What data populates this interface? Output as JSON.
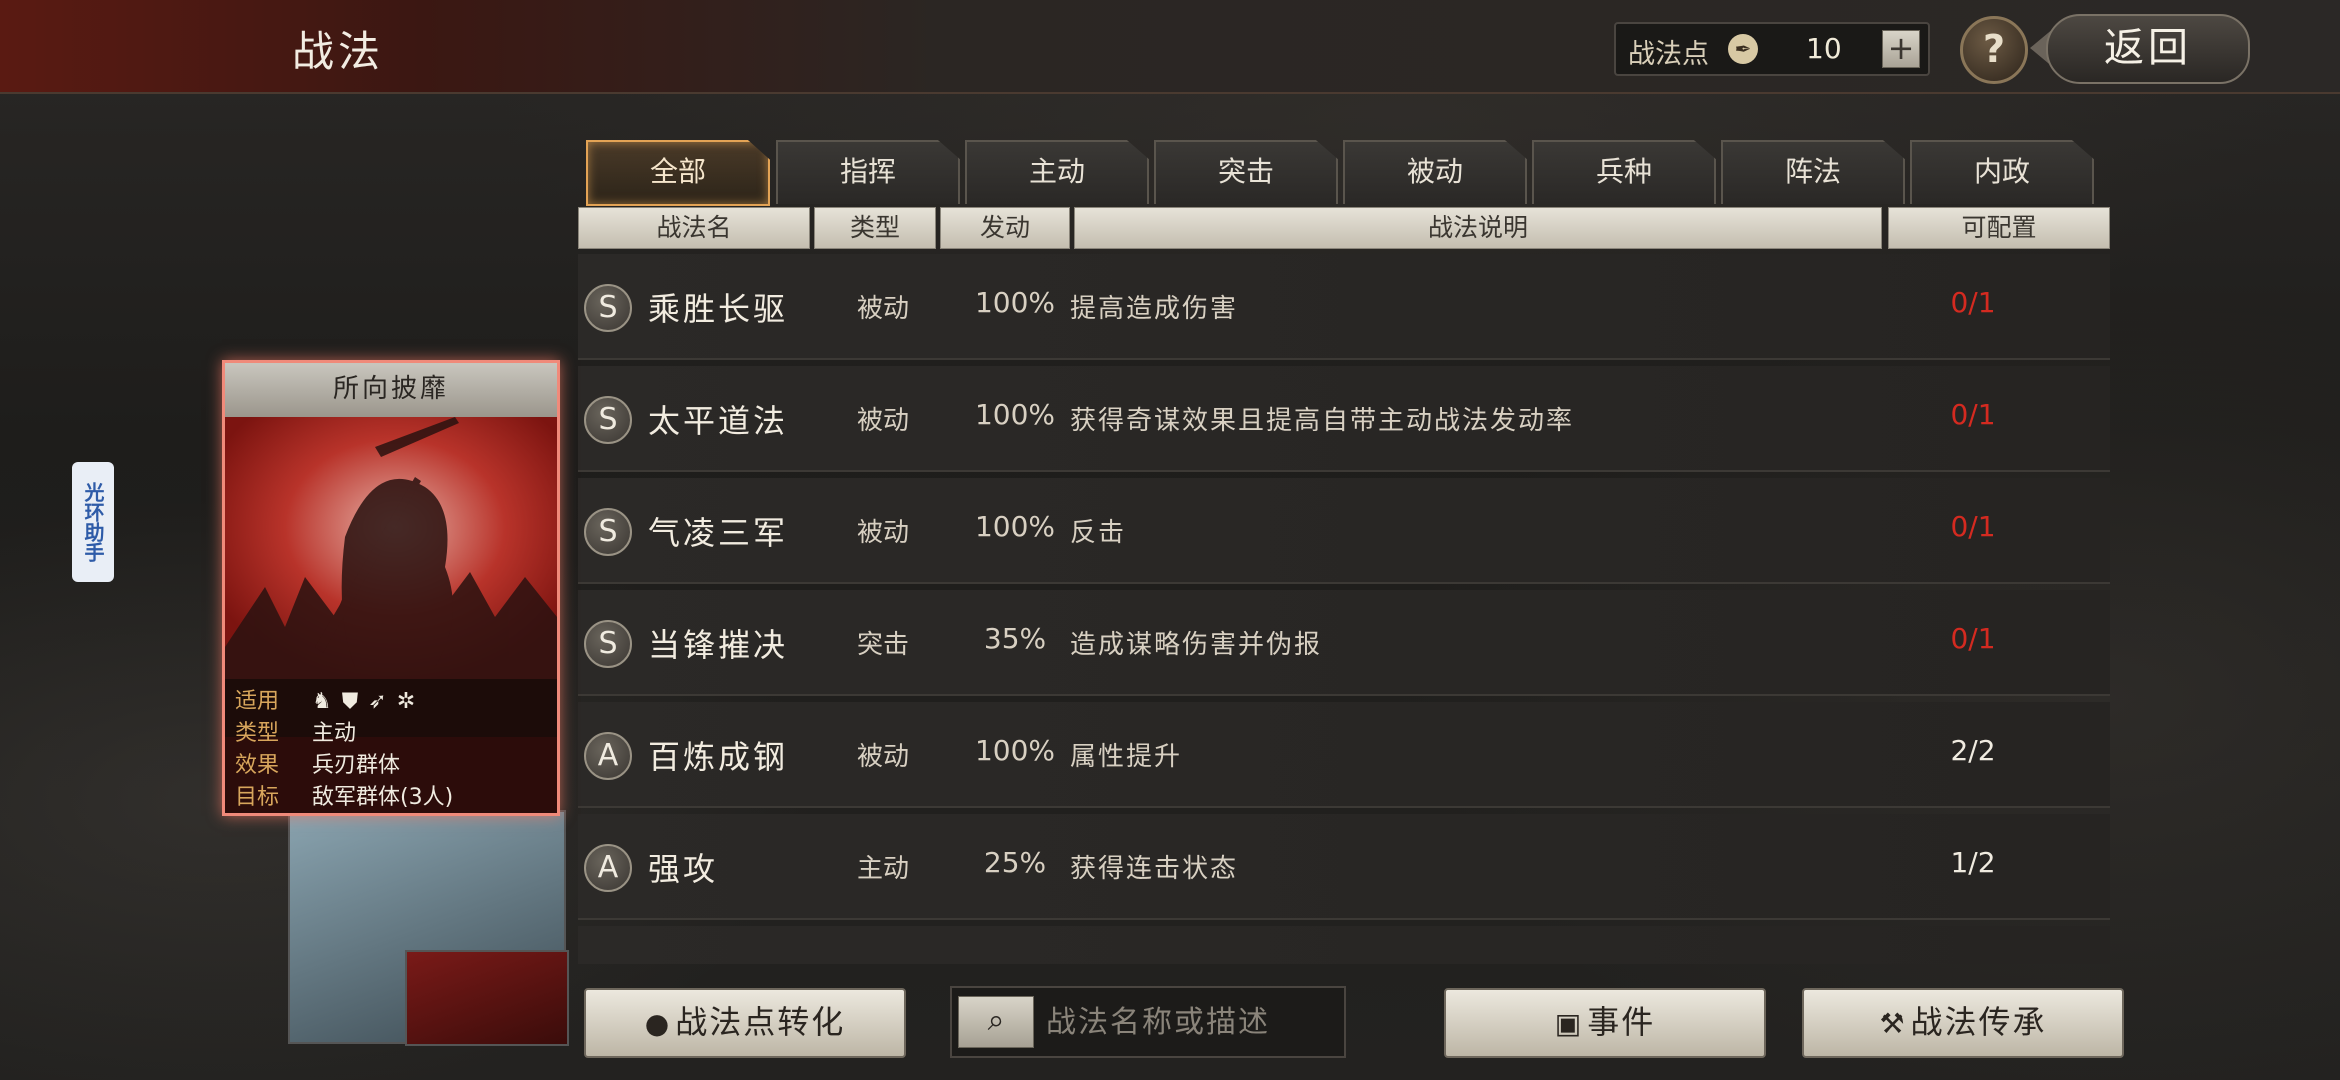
{
  "header": {
    "title": "战法",
    "points_label": "战法点",
    "points_value": "10",
    "add_label": "+",
    "help_label": "?",
    "back_label": "返回"
  },
  "assistant_tab": {
    "label": "光环助手"
  },
  "tabs": [
    {
      "label": "全部",
      "active": true
    },
    {
      "label": "指挥"
    },
    {
      "label": "主动"
    },
    {
      "label": "突击"
    },
    {
      "label": "被动"
    },
    {
      "label": "兵种"
    },
    {
      "label": "阵法"
    },
    {
      "label": "内政"
    }
  ],
  "columns": {
    "name": "战法名",
    "type": "类型",
    "rate": "发动",
    "desc": "战法说明",
    "config": "可配置"
  },
  "tactics": [
    {
      "grade": "S",
      "name": "乘胜长驱",
      "type": "被动",
      "rate": "100%",
      "desc": "提高造成伤害",
      "config": "0/1",
      "config_color": "#d42a20"
    },
    {
      "grade": "S",
      "name": "太平道法",
      "type": "被动",
      "rate": "100%",
      "desc": "获得奇谋效果且提高自带主动战法发动率",
      "config": "0/1",
      "config_color": "#d42a20"
    },
    {
      "grade": "S",
      "name": "气凌三军",
      "type": "被动",
      "rate": "100%",
      "desc": "反击",
      "config": "0/1",
      "config_color": "#d42a20"
    },
    {
      "grade": "S",
      "name": "当锋摧决",
      "type": "突击",
      "rate": "35%",
      "desc": "造成谋略伤害并伪报",
      "config": "0/1",
      "config_color": "#d42a20"
    },
    {
      "grade": "A",
      "name": "百炼成钢",
      "type": "被动",
      "rate": "100%",
      "desc": "属性提升",
      "config": "2/2",
      "config_color": "#f0ebe0"
    },
    {
      "grade": "A",
      "name": "强攻",
      "type": "主动",
      "rate": "25%",
      "desc": "获得连击状态",
      "config": "1/2",
      "config_color": "#f0ebe0"
    }
  ],
  "detail_card": {
    "title": "所向披靡",
    "apply_key": "适用",
    "type_key": "类型",
    "type_val": "主动",
    "effect_key": "效果",
    "effect_val": "兵刃群体",
    "target_key": "目标",
    "target_val": "敌军群体(3人)"
  },
  "bottom": {
    "convert_label": "战法点转化",
    "search_placeholder": "战法名称或描述",
    "events_label": "事件",
    "inherit_label": "战法传承"
  }
}
